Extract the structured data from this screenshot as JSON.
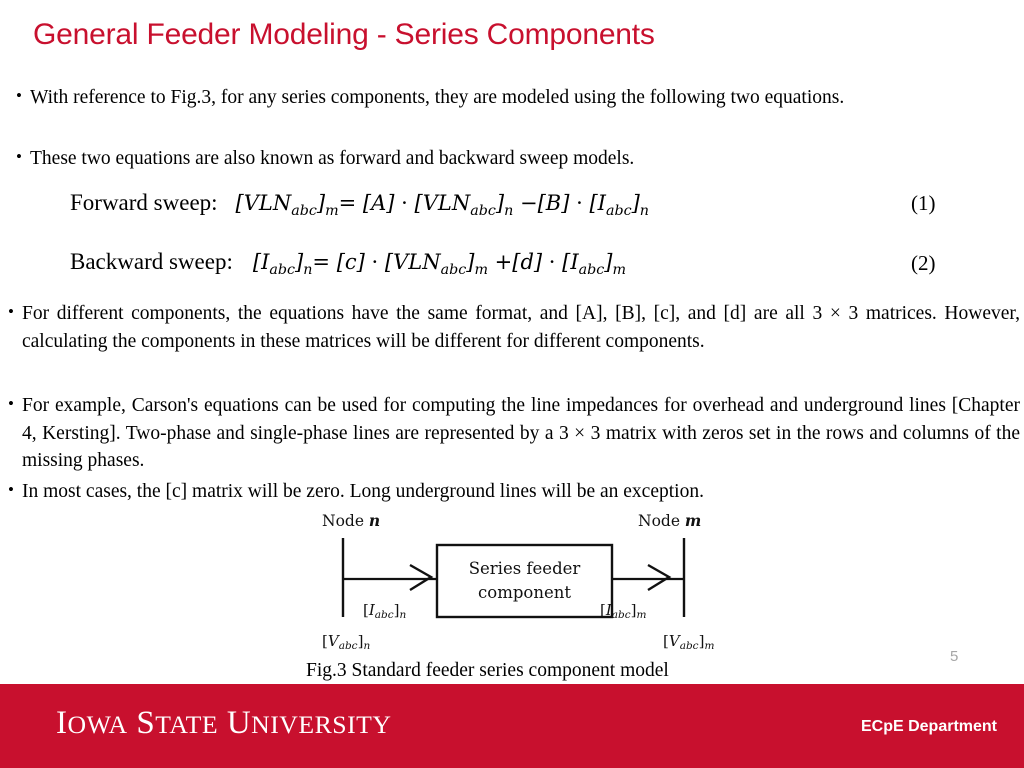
{
  "slide": {
    "title": "General Feeder Modeling - Series Components",
    "page_number": "5",
    "title_color": "#C8102E",
    "footer_color": "#C8102E"
  },
  "bullets": [
    {
      "marker": "•",
      "text": "With reference to Fig.3, for any series components, they are modeled using the following two equations."
    },
    {
      "marker": "•",
      "text": "These two equations are also known as forward and backward sweep models."
    },
    {
      "marker": "•",
      "text": "For different components, the equations have the same format, and [A], [B], [c], and [d] are all 3 × 3 matrices. However, calculating the components in these matrices will be different for different components."
    },
    {
      "marker": "•",
      "text": "For example, Carson's equations can be used for computing the line impedances for overhead and underground lines [Chapter 4, Kersting]. Two-phase and single-phase lines are represented by a 3 × 3 matrix with zeros set in the rows and columns of the missing phases."
    },
    {
      "marker": "•",
      "text": "In most cases, the [c] matrix will be zero. Long underground lines will be an exception."
    }
  ],
  "equations": [
    {
      "label": "Forward sweep:",
      "number": "(1)",
      "plain": "[VLNabc]m = [A] · [VLNabc]n − [B] · [Iabc]n"
    },
    {
      "label": "Backward sweep:",
      "number": "(2)",
      "plain": "[Iabc]n = [c] · [VLNabc]m + [d] · [Iabc]m"
    }
  ],
  "figure": {
    "caption": "Fig.3 Standard feeder series component model",
    "node_left_label": "Node n",
    "node_right_label": "Node m",
    "box_line1": "Series feeder",
    "box_line2": "component",
    "current_left": "[Iabc]n",
    "current_right": "[Iabc]m",
    "voltage_left": "[Vabc]n",
    "voltage_right": "[Vabc]m"
  },
  "footer": {
    "logo_text": "IOWA STATE UNIVERSITY",
    "logo_parts": [
      "I",
      "OWA ",
      "S",
      "TATE ",
      "U",
      "NIVERSITY"
    ],
    "department": "ECpE Department"
  }
}
